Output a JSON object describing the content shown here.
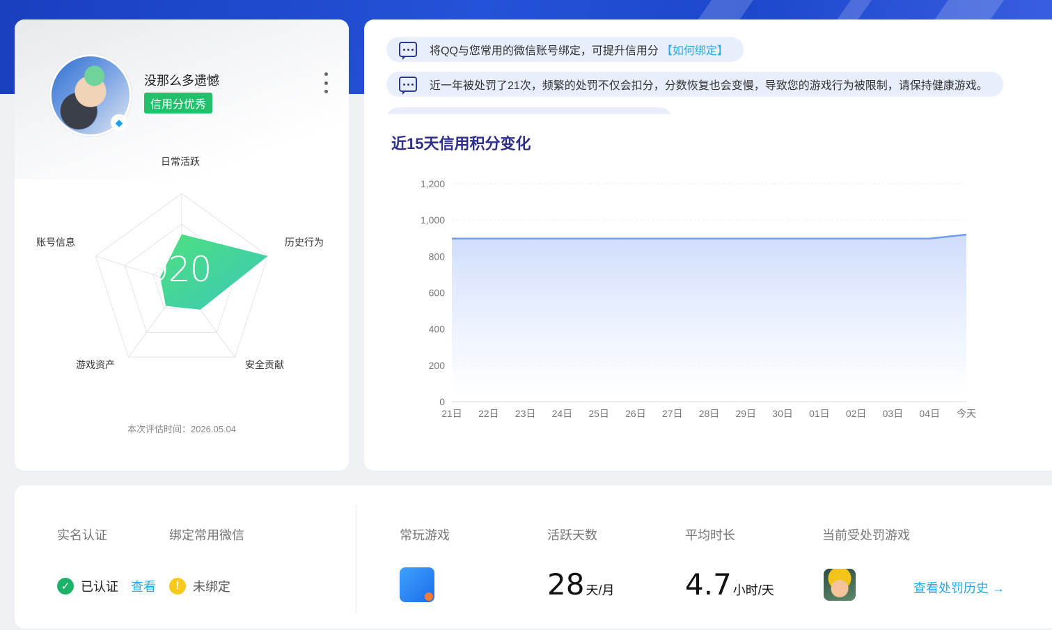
{
  "profile": {
    "username": "没那么多遗憾",
    "credit_level": "信用分优秀",
    "score": "920",
    "eval_time": "本次评估时间：2026.05.04",
    "radar": {
      "labels": [
        "日常活跃",
        "历史行为",
        "安全贡献",
        "游戏资产",
        "账号信息"
      ],
      "values": [
        0.55,
        1.0,
        0.35,
        0.3,
        0.25
      ]
    }
  },
  "notices": [
    {
      "text": "将QQ与您常用的微信账号绑定，可提升信用分",
      "link": "【如何绑定】"
    },
    {
      "text": "近一年被处罚了21次，频繁的处罚不仅会扣分，分数恢复也会变慢，导致您的游戏行为被限制，请保持健康游戏。",
      "link": ""
    }
  ],
  "chart_title": "近15天信用积分变化",
  "chart_data": {
    "type": "area",
    "title": "近15天信用积分变化",
    "x": [
      "21日",
      "22日",
      "23日",
      "24日",
      "25日",
      "26日",
      "27日",
      "28日",
      "29日",
      "30日",
      "01日",
      "02日",
      "03日",
      "04日",
      "今天"
    ],
    "values": [
      898,
      898,
      898,
      898,
      898,
      898,
      898,
      898,
      898,
      898,
      898,
      898,
      898,
      898,
      920
    ],
    "yticks": [
      "0",
      "200",
      "400",
      "600",
      "800",
      "1,000",
      "1,200"
    ],
    "ylim": [
      0,
      1200
    ],
    "grid": true
  },
  "stats": {
    "realname_label": "实名认证",
    "wechat_label": "绑定常用微信",
    "realname_status": "已认证",
    "realname_view": "查看",
    "wechat_status": "未绑定",
    "games_label": "常玩游戏",
    "active_label": "活跃天数",
    "active_value": "28",
    "active_unit": "天/月",
    "avg_label": "平均时长",
    "avg_value": "4.7",
    "avg_unit": "小时/天",
    "punished_label": "当前受处罚游戏",
    "history_link": "查看处罚历史 →"
  },
  "colors": {
    "accent_green": "#23c06b",
    "link_blue": "#2aa7e8",
    "title_navy": "#2c2f8e",
    "line_blue": "#6f9cf2"
  }
}
